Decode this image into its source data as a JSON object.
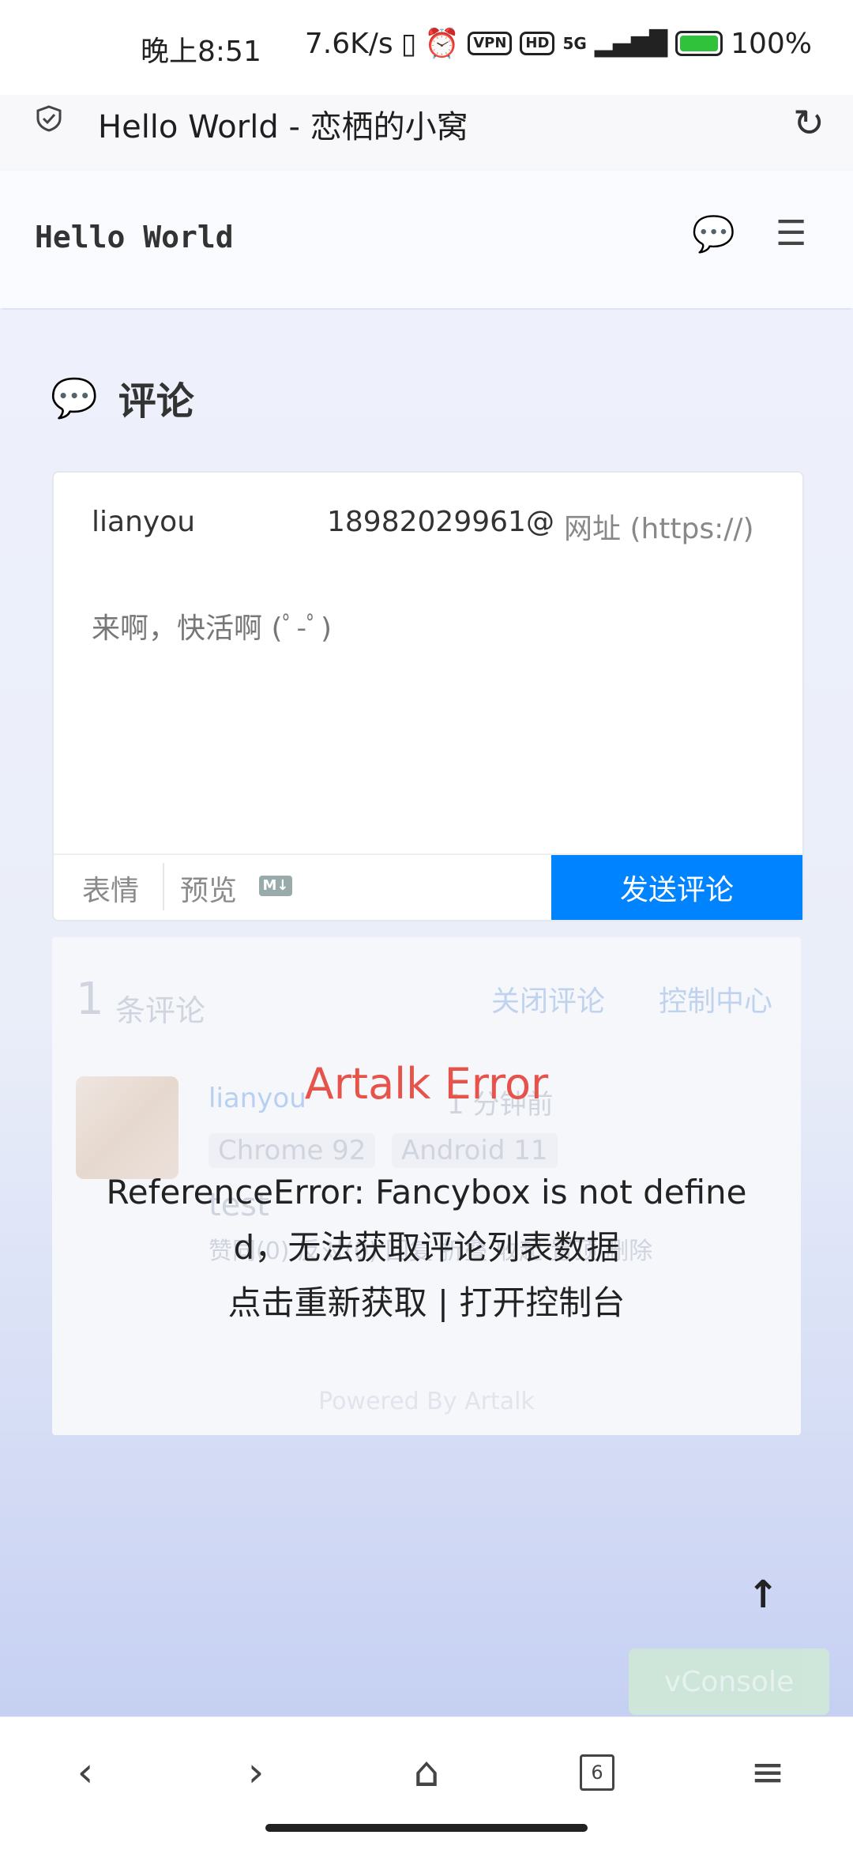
{
  "status_bar": {
    "time": "晚上8:51",
    "speed": "7.6K/s",
    "vpn": "VPN",
    "hd": "HD",
    "network": "5G",
    "battery": "100%"
  },
  "browser": {
    "page_title": "Hello World - 恋栖的小窝",
    "tabs_count": "6"
  },
  "site": {
    "name": "Hello World"
  },
  "comments": {
    "section_title": "评论",
    "name_value": "lianyou",
    "email_value": "18982029961@",
    "url_placeholder": "网址 (https://)",
    "textarea_placeholder": "来啊，快活啊 (ﾟ-ﾟ)",
    "toolbar": {
      "emoji": "表情",
      "preview": "预览",
      "md": "M↓",
      "send": "发送评论"
    },
    "list": {
      "count": "1",
      "count_label": "条评论",
      "close_comments": "关闭评论",
      "control_center": "控制中心",
      "item": {
        "author": "lianyou",
        "time": "1 分钟前",
        "browser": "Chrome 92",
        "os": "Android 11",
        "content": "test",
        "actions": "赞同(0)  反对(0)  回复  折叠  收起  置顶  删除"
      },
      "powered_by": "Powered By Artalk"
    },
    "error": {
      "title": "Artalk Error",
      "line1": "ReferenceError: Fancybox is not define",
      "line2": "d，无法获取评论列表数据",
      "line3": "点击重新获取 | 打开控制台"
    }
  },
  "floating": {
    "back_to_top": "↑",
    "vconsole": "vConsole"
  },
  "colors": {
    "accent": "#0083ff",
    "error": "#e5534b",
    "battery": "#30c23a"
  }
}
